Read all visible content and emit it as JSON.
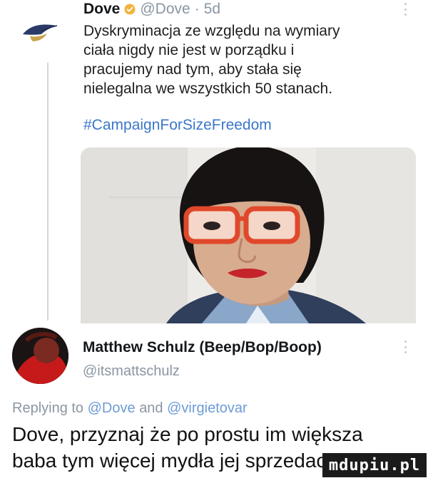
{
  "tweet1": {
    "name": "Dove",
    "handle": "@Dove",
    "separator": "·",
    "time": "5d",
    "text_lines": [
      "Dyskryminacja ze względu na wymiary",
      "ciała nigdy nie jest w porządku i",
      "pracujemy nad tym, aby stała się",
      "nielegalna we wszystkich 50 stanach."
    ],
    "hashtag": "#CampaignForSizeFreedom"
  },
  "tweet2": {
    "name": "Matthew Schulz (Beep/Bop/Boop)",
    "handle": "@itsmattschulz",
    "replying_prefix": "Replying to",
    "replying_mention1": "@Dove",
    "replying_and": "and",
    "replying_mention2": "@virgietovar",
    "text_lines": [
      "Dove, przyznaj że po prostu im większa",
      "baba tym więcej mydła jej sprzedacie"
    ]
  },
  "watermark": "mdupiu.pl",
  "colors": {
    "link": "#3b77c9",
    "muted": "#8a96a3",
    "verified": "#f2b33d",
    "thread_line": "#cfd9de"
  },
  "icons": {
    "verified": "verified-badge-icon",
    "more": "more-options-icon",
    "dove_logo": "dove-bird-logo"
  }
}
